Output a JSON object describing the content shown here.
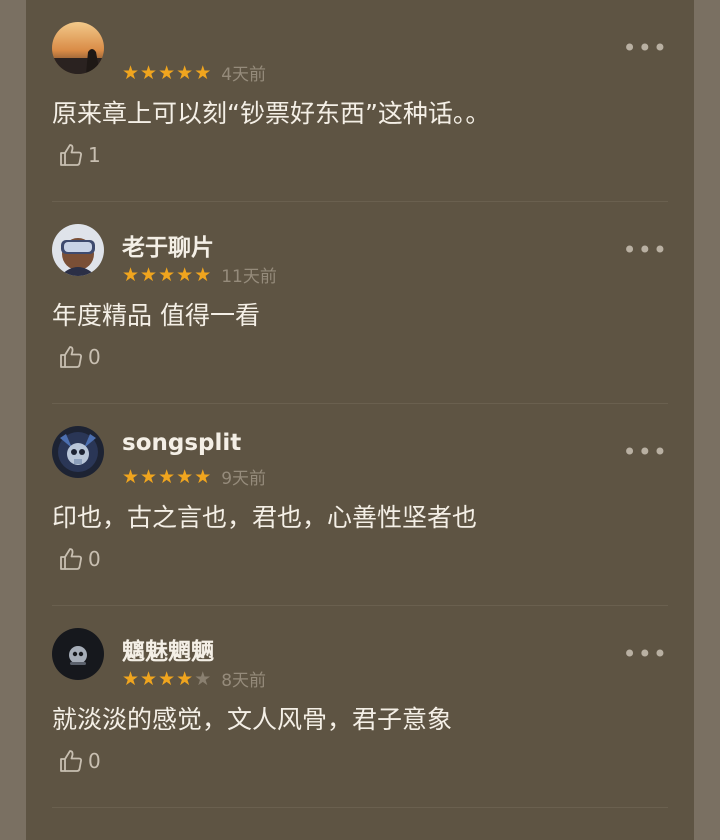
{
  "reviews": [
    {
      "name": "",
      "avatar_icon": "sunset-avatar-icon",
      "rating": 5,
      "stars": [
        "★",
        "★",
        "★",
        "★",
        "★"
      ],
      "time": "4天前",
      "more": "•••",
      "content": "原来章上可以刻“钞票好东西”这种话。。",
      "likes": "1"
    },
    {
      "name": "老于聊片",
      "avatar_icon": "vr-headset-avatar-icon",
      "rating": 5,
      "stars": [
        "★",
        "★",
        "★",
        "★",
        "★"
      ],
      "time": "11天前",
      "more": "•••",
      "content": "年度精品 值得一看",
      "likes": "0"
    },
    {
      "name": "songsplit",
      "avatar_icon": "skull-avatar-icon",
      "rating": 5,
      "stars": [
        "★",
        "★",
        "★",
        "★",
        "★"
      ],
      "time": "9天前",
      "more": "•••",
      "content": "印也，古之言也，君也，心善性坚者也",
      "likes": "0"
    },
    {
      "name": "魑魅魍魉",
      "avatar_icon": "dark-mask-avatar-icon",
      "rating": 4,
      "stars": [
        "★",
        "★",
        "★",
        "★",
        "★"
      ],
      "time": "8天前",
      "more": "•••",
      "content": "就淡淡的感觉，文人风骨，君子意象",
      "likes": "0"
    }
  ],
  "colors": {
    "background": "#5e5443",
    "star_on": "#f0a51e",
    "star_off": "#8a8070",
    "text": "#f4efe6",
    "muted": "#958b7b"
  }
}
